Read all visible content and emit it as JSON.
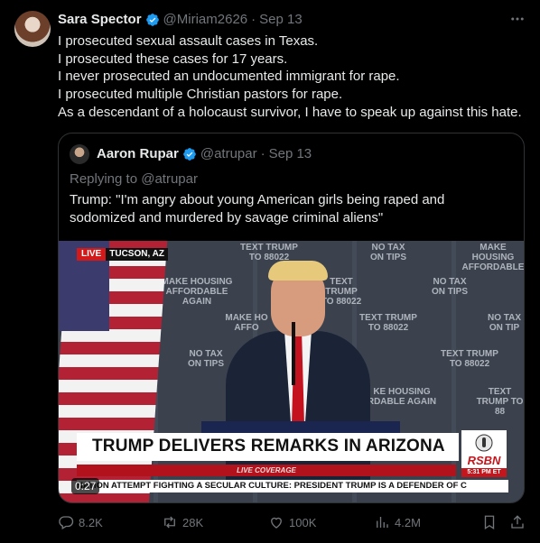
{
  "tweet": {
    "author_name": "Sara Spector",
    "handle": "@Miriam2626",
    "separator": "·",
    "date": "Sep 13",
    "lines": [
      "I prosecuted sexual assault cases in Texas.",
      "I prosecuted these cases for 17 years.",
      "I never prosecuted an undocumented immigrant for rape.",
      "I prosecuted multiple Christian pastors for rape.",
      "As a descendant of a holocaust survivor, I have to speak up against this hate."
    ]
  },
  "quoted": {
    "author_name": "Aaron Rupar",
    "handle": "@atrupar",
    "separator": "·",
    "date": "Sep 13",
    "reply_to": "Replying to @atrupar",
    "text": "Trump: \"I'm angry about young American girls being raped and sodomized and murdered by savage criminal aliens\"",
    "video": {
      "live_label": "LIVE",
      "location": "TUCSON, AZ",
      "banner": "TRUMP DELIVERS REMARKS IN ARIZONA",
      "coverage": "LIVE COVERAGE",
      "rsbn_logo": "RSBN",
      "time": "5:31 PM ET",
      "ticker": "NATION ATTEMPT   FIGHTING A SECULAR CULTURE: PRESIDENT TRUMP IS A DEFENDER OF C",
      "duration": "0:27",
      "backdrop_signs": [
        "TEXT TRUMP TO 88022",
        "NO TAX ON TIPS",
        "MAKE HOUSING AFFORDABLE",
        "MAKE HOUSING AFFORDABLE AGAIN",
        "TEXT TRUMP TO 88022",
        "NO TAX ON TIPS",
        "MAKE HO AFFO",
        "TEXT TRUMP TO 88022",
        "NO TAX ON TIP",
        "NO TAX ON TIPS",
        "TEXT TRUMP TO 88022",
        "KE HOUSING RDABLE AGAIN",
        "TEXT TRUMP TO 88"
      ]
    }
  },
  "actions": {
    "replies": "8.2K",
    "reposts": "28K",
    "likes": "100K",
    "views": "4.2M"
  },
  "colors": {
    "background": "#000000",
    "text": "#e7e9ea",
    "muted": "#71767b",
    "verified": "#1d9bf0",
    "border": "#2f3336"
  }
}
